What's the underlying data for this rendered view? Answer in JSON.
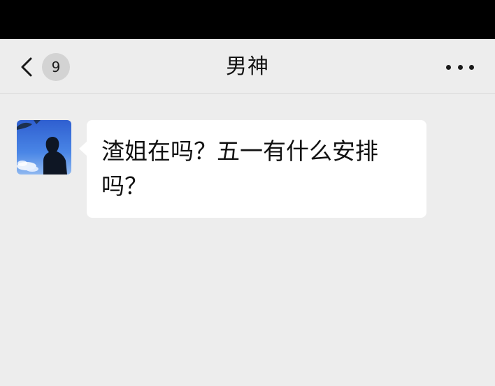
{
  "header": {
    "back_icon": "chevron-left-icon",
    "unread_count": "9",
    "title": "男神",
    "more_icon": "ellipsis-icon"
  },
  "messages": [
    {
      "sender": "incoming",
      "avatar_icon": "avatar-silhouette-sky",
      "text": "渣姐在吗？五一有什么安排吗？"
    }
  ],
  "colors": {
    "background": "#ededed",
    "status_bar": "#000000",
    "bubble": "#ffffff",
    "badge": "#d3d3d3",
    "text": "#111111"
  }
}
